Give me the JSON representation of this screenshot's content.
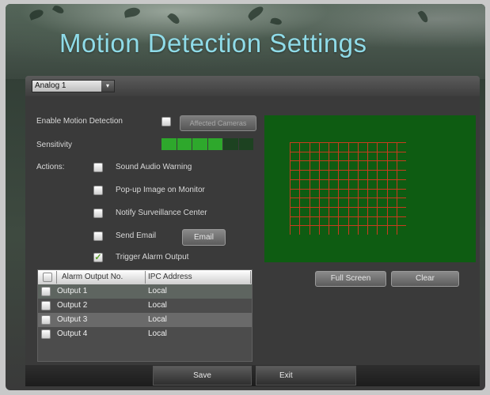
{
  "title": "Motion Detection Settings",
  "camera_select": {
    "value": "Analog 1",
    "arrow": "▾"
  },
  "enable": {
    "label": "Enable Motion Detection",
    "checked": false
  },
  "affected_cameras_label": "Affected Cameras",
  "sensitivity": {
    "label": "Sensitivity",
    "level": 4,
    "max": 6
  },
  "actions": {
    "label": "Actions:",
    "items": [
      {
        "label": "Sound Audio Warning",
        "checked": false
      },
      {
        "label": "Pop-up Image on Monitor",
        "checked": false
      },
      {
        "label": "Notify Surveillance Center",
        "checked": false
      },
      {
        "label": "Send Email",
        "checked": false
      },
      {
        "label": "Trigger Alarm Output",
        "checked": true
      }
    ],
    "email_button": "Email"
  },
  "table": {
    "headers": [
      "Alarm Output No.",
      "IPC Address"
    ],
    "rows": [
      {
        "output": "Output 1",
        "address": "Local"
      },
      {
        "output": "Output 2",
        "address": "Local"
      },
      {
        "output": "Output 3",
        "address": "Local"
      },
      {
        "output": "Output 4",
        "address": "Local"
      }
    ]
  },
  "preview": {
    "full_screen": "Full Screen",
    "clear": "Clear"
  },
  "footer": {
    "save": "Save",
    "exit": "Exit"
  },
  "colors": {
    "title": "#8fdbe8",
    "preview_bg": "#0e5c12",
    "grid": "#c83c1e",
    "sensitivity_on": "#2ea82c",
    "sensitivity_off": "#1d4221",
    "check": "#5aa028"
  },
  "icons": {
    "dropdown": "chevron-down-icon",
    "checkmark": "checkmark-icon"
  }
}
